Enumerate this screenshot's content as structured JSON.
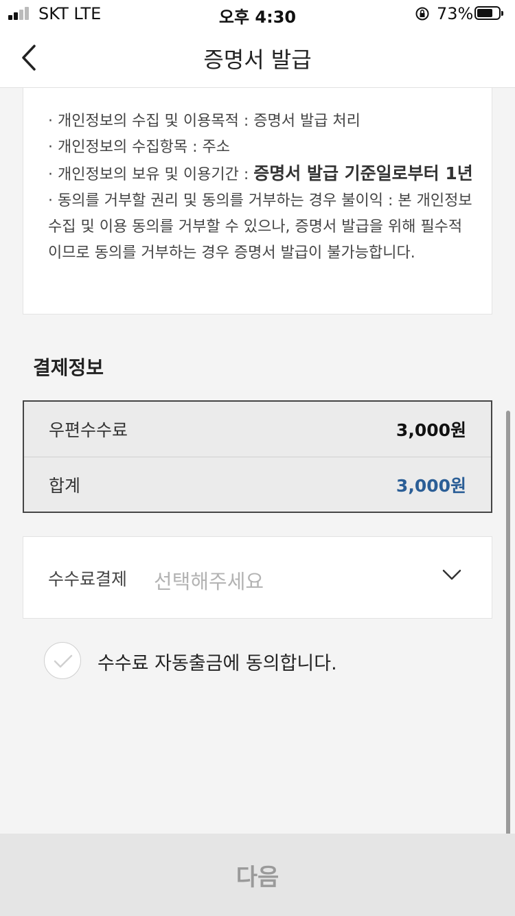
{
  "status_bar": {
    "carrier": "SKT   LTE",
    "time": "오후 4:30",
    "battery_percent": "73%",
    "battery_level": 0.73
  },
  "header": {
    "title": "증명서 발급",
    "back_icon": "chevron-left-icon"
  },
  "privacy": {
    "items": [
      "· 개인정보의 수집 및 이용목적 : 증명서 발급 처리",
      "· 개인정보의 수집항목 : 주소"
    ],
    "retention_prefix": "· 개인정보의 보유 및 이용기간 : ",
    "retention_value": "증명서 발급 기준일로부터 1년",
    "refusal": "· 동의를 거부할 권리 및 동의를 거부하는 경우 불이익 : 본 개인정보수집 및 이용 동의를 거부할 수 있으나, 증명서 발급을 위해 필수적이므로 동의를 거부하는 경우 증명서 발급이 불가능합니다."
  },
  "payment": {
    "section_title": "결제정보",
    "rows": [
      {
        "label": "우편수수료",
        "value": "3,000원"
      },
      {
        "label": "합계",
        "value": "3,000원"
      }
    ],
    "total_color": "#2b5e96"
  },
  "fee_payment": {
    "label": "수수료결제",
    "placeholder": "선택해주세요",
    "icon": "chevron-down-icon"
  },
  "agree": {
    "text": "수수료 자동출금에 동의합니다.",
    "checked": false,
    "icon": "check-icon"
  },
  "footer": {
    "next_label": "다음"
  }
}
